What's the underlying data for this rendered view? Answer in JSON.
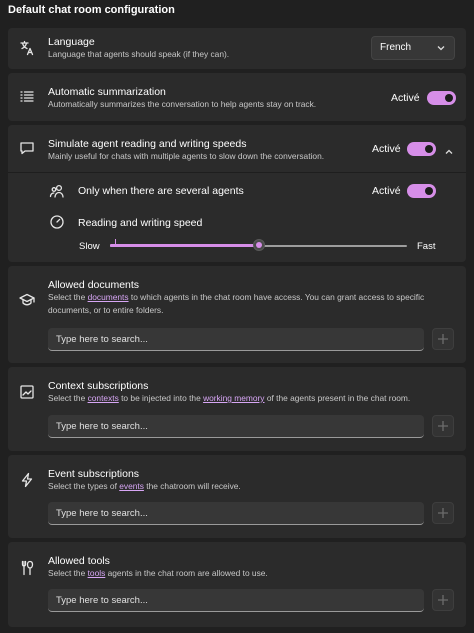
{
  "page_title": "Default chat room configuration",
  "language": {
    "title": "Language",
    "desc": "Language that agents should speak (if they can).",
    "selected": "French",
    "icon": "language-icon"
  },
  "summarization": {
    "title": "Automatic summarization",
    "desc": "Automatically summarizes the conversation to help agents stay on track.",
    "state": "Activé",
    "icon": "list-icon"
  },
  "simulate": {
    "title": "Simulate agent reading and writing speeds",
    "desc": "Mainly useful for chats with multiple agents to slow down the conversation.",
    "state": "Activé",
    "icon": "chat-icon",
    "several_agents": {
      "label": "Only when there are several agents",
      "state": "Activé",
      "icon": "people-icon"
    },
    "speed": {
      "label": "Reading and writing speed",
      "slow": "Slow",
      "fast": "Fast",
      "value": 0.5,
      "icon": "gauge-icon"
    }
  },
  "documents": {
    "title": "Allowed documents",
    "desc_pre": "Select the ",
    "desc_link": "documents",
    "desc_post": " to which agents in the chat room have access. You can grant access to specific",
    "desc_line2": "documents, or to entire folders.",
    "placeholder": "Type here to search...",
    "icon": "graduation-cap-icon"
  },
  "context": {
    "title": "Context subscriptions",
    "desc_pre": "Select the ",
    "desc_link": "contexts",
    "desc_mid": " to be injected into the ",
    "desc_link2": "working memory",
    "desc_post": " of the agents present in the chat room.",
    "placeholder": "Type here to search...",
    "icon": "image-frame-icon"
  },
  "events": {
    "title": "Event subscriptions",
    "desc_pre": "Select the types of ",
    "desc_link": "events",
    "desc_post": " the chatroom will receive.",
    "placeholder": "Type here to search...",
    "icon": "lightning-icon"
  },
  "tools": {
    "title": "Allowed tools",
    "desc_pre": "Select the ",
    "desc_link": "tools",
    "desc_post": " agents in the chat room are allowed to use.",
    "placeholder": "Type here to search...",
    "icon": "tools-icon"
  },
  "colors": {
    "accent": "#d68ee8",
    "link": "#d7a6f5",
    "card": "#2b2b2b",
    "background": "#202020"
  }
}
